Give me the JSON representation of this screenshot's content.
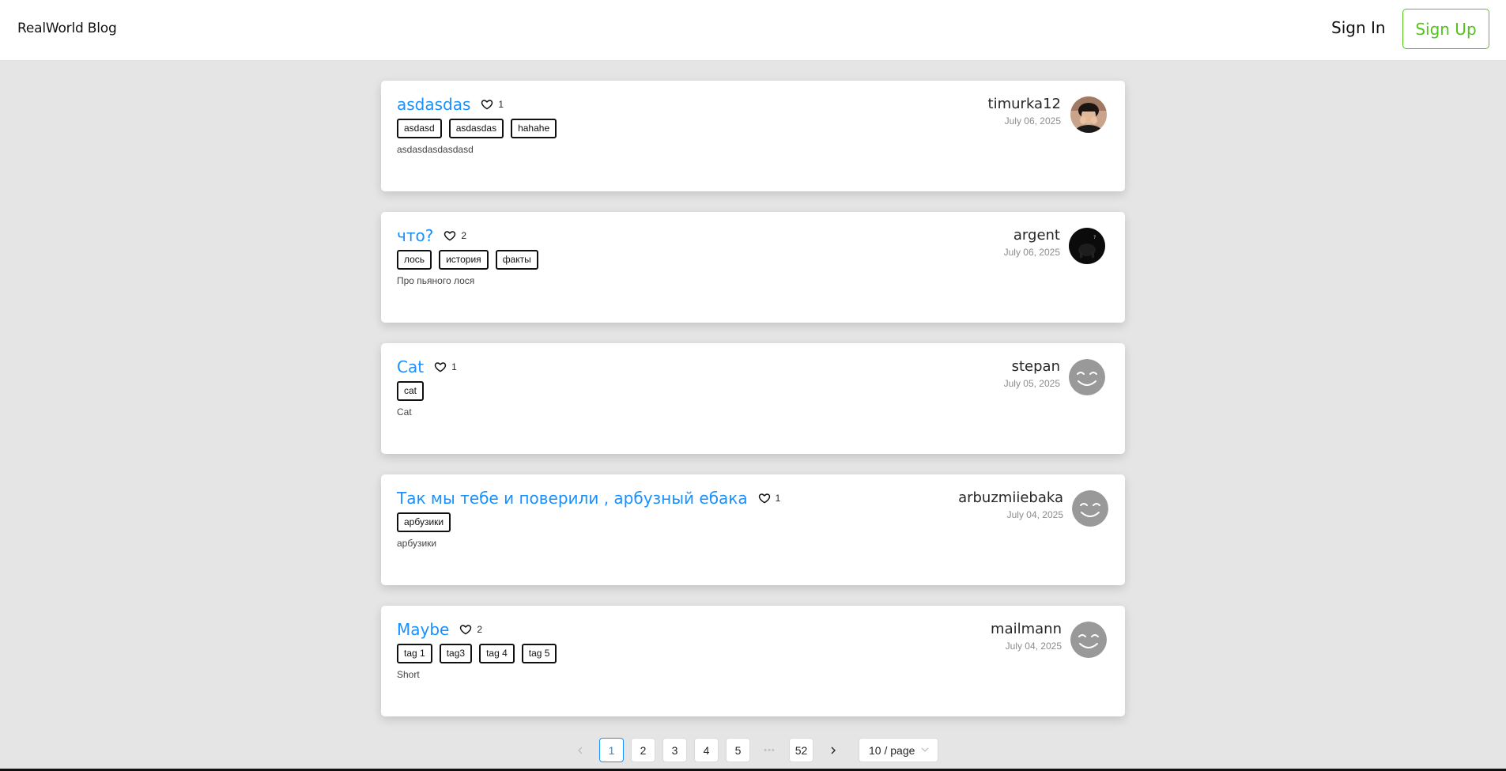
{
  "header": {
    "logo": "RealWorld Blog",
    "sign_in": "Sign In",
    "sign_up": "Sign Up"
  },
  "articles": [
    {
      "title": "asdasdas",
      "likes": "1",
      "tags": [
        "asdasd",
        "asdasdas",
        "hahahe"
      ],
      "description": "asdasdasdasdasd",
      "author": "timurka12",
      "date": "July 06, 2025",
      "avatar": "photo"
    },
    {
      "title": "что?",
      "likes": "2",
      "tags": [
        "лось",
        "история",
        "факты"
      ],
      "description": "Про пьяного лося",
      "author": "argent",
      "date": "July 06, 2025",
      "avatar": "dark-photo"
    },
    {
      "title": "Cat",
      "likes": "1",
      "tags": [
        "cat"
      ],
      "description": "Cat",
      "author": "stepan",
      "date": "July 05, 2025",
      "avatar": "smiley"
    },
    {
      "title": "Так мы тебе и поверили , арбузный ебака",
      "likes": "1",
      "tags": [
        "арбузики"
      ],
      "description": "арбузики",
      "author": "arbuzmiiebaka",
      "date": "July 04, 2025",
      "avatar": "smiley"
    },
    {
      "title": "Maybe",
      "likes": "2",
      "tags": [
        "tag 1",
        "tag3",
        "tag 4",
        "tag 5"
      ],
      "description": "Short",
      "author": "mailmann",
      "date": "July 04, 2025",
      "avatar": "smiley"
    }
  ],
  "pagination": {
    "prev_icon": "chevron-left-icon",
    "next_icon": "chevron-right-icon",
    "pages": [
      "1",
      "2",
      "3",
      "4",
      "5"
    ],
    "ellipsis": "•••",
    "last": "52",
    "current": "1",
    "page_size": "10 / page"
  },
  "colors": {
    "accent": "#1890ff",
    "signup": "#52c41a",
    "background": "#e5e5e5"
  }
}
